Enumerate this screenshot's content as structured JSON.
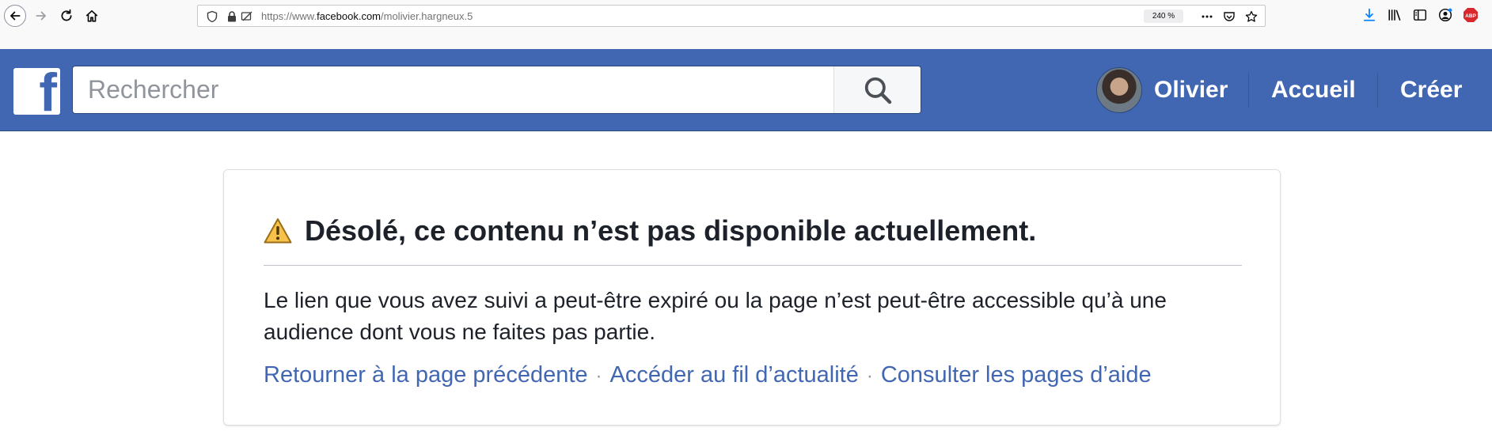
{
  "browser": {
    "url_prefix": "https://www.",
    "url_host": "facebook.com",
    "url_path": "/molivier.hargneux.5",
    "zoom": "240 %",
    "extension_badge": "ABP"
  },
  "header": {
    "logo_letter": "f",
    "search_placeholder": "Rechercher",
    "user_name": "Olivier",
    "nav_home": "Accueil",
    "nav_create": "Créer",
    "brand_color": "#4267b2"
  },
  "error_card": {
    "title": "Désolé, ce contenu n’est pas disponible actuellement.",
    "body": "Le lien que vous avez suivi a peut-être expiré ou la page n’est peut-être accessible qu’à une audience dont vous ne faites pas partie.",
    "links": [
      "Retourner à la page précédente",
      "Accéder au fil d’actualité",
      "Consulter les pages d’aide"
    ],
    "separator": "·"
  },
  "icons": {
    "back": "arrow-left-icon",
    "forward": "arrow-right-icon",
    "reload": "reload-icon",
    "home": "home-icon",
    "warning": "warning-icon"
  }
}
